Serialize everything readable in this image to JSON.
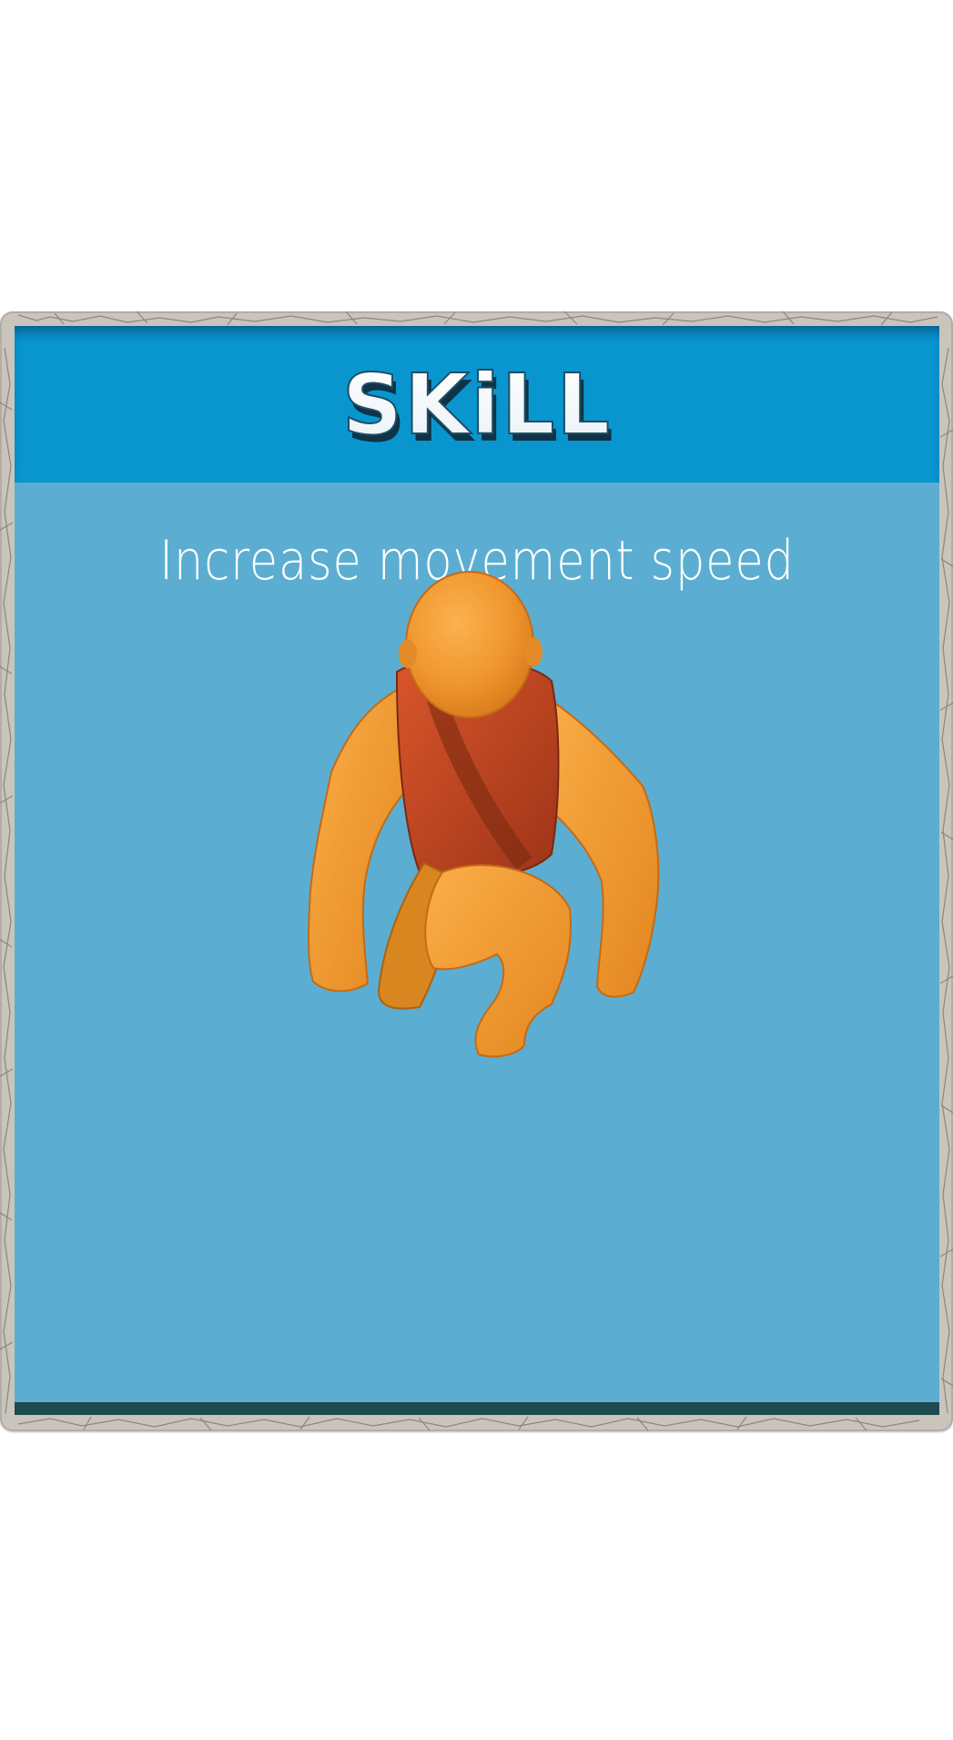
{
  "skill_card": {
    "title": "SKiLL",
    "description": "Increase movement speed",
    "character_icon": "crouching-caveman-figure"
  },
  "colors": {
    "panel_background": "#5baed1",
    "header_background": "#0996cf",
    "frame_stone": "#c9c5bc",
    "title_text": "#ffffff",
    "character_skin": "#f0962e",
    "character_clothing": "#c0431f"
  }
}
